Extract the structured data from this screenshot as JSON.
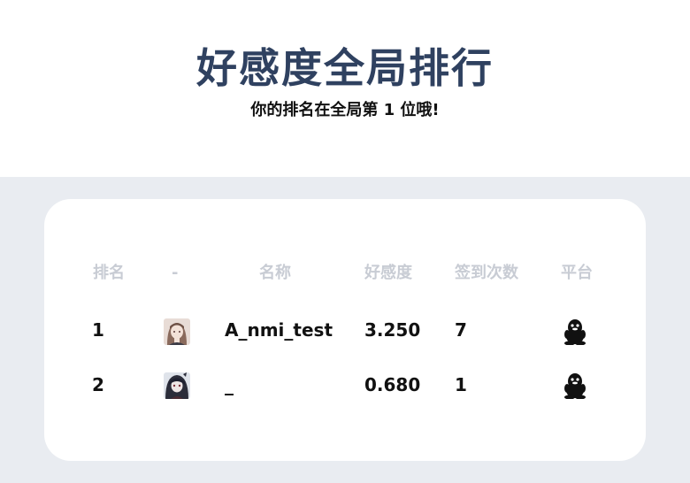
{
  "header": {
    "title": "好感度全局排行",
    "subtitle": "你的排名在全局第 1 位哦!"
  },
  "table": {
    "columns": {
      "rank": "排名",
      "avatar": "-",
      "name": "名称",
      "favor": "好感度",
      "checkins": "签到次数",
      "platform": "平台"
    },
    "rows": [
      {
        "rank": "1",
        "name": "A_nmi_test",
        "favor": "3.250",
        "checkins": "7",
        "platform_icon": "qq-penguin-icon"
      },
      {
        "rank": "2",
        "name": "_",
        "favor": "0.680",
        "checkins": "1",
        "platform_icon": "qq-penguin-icon"
      }
    ]
  }
}
